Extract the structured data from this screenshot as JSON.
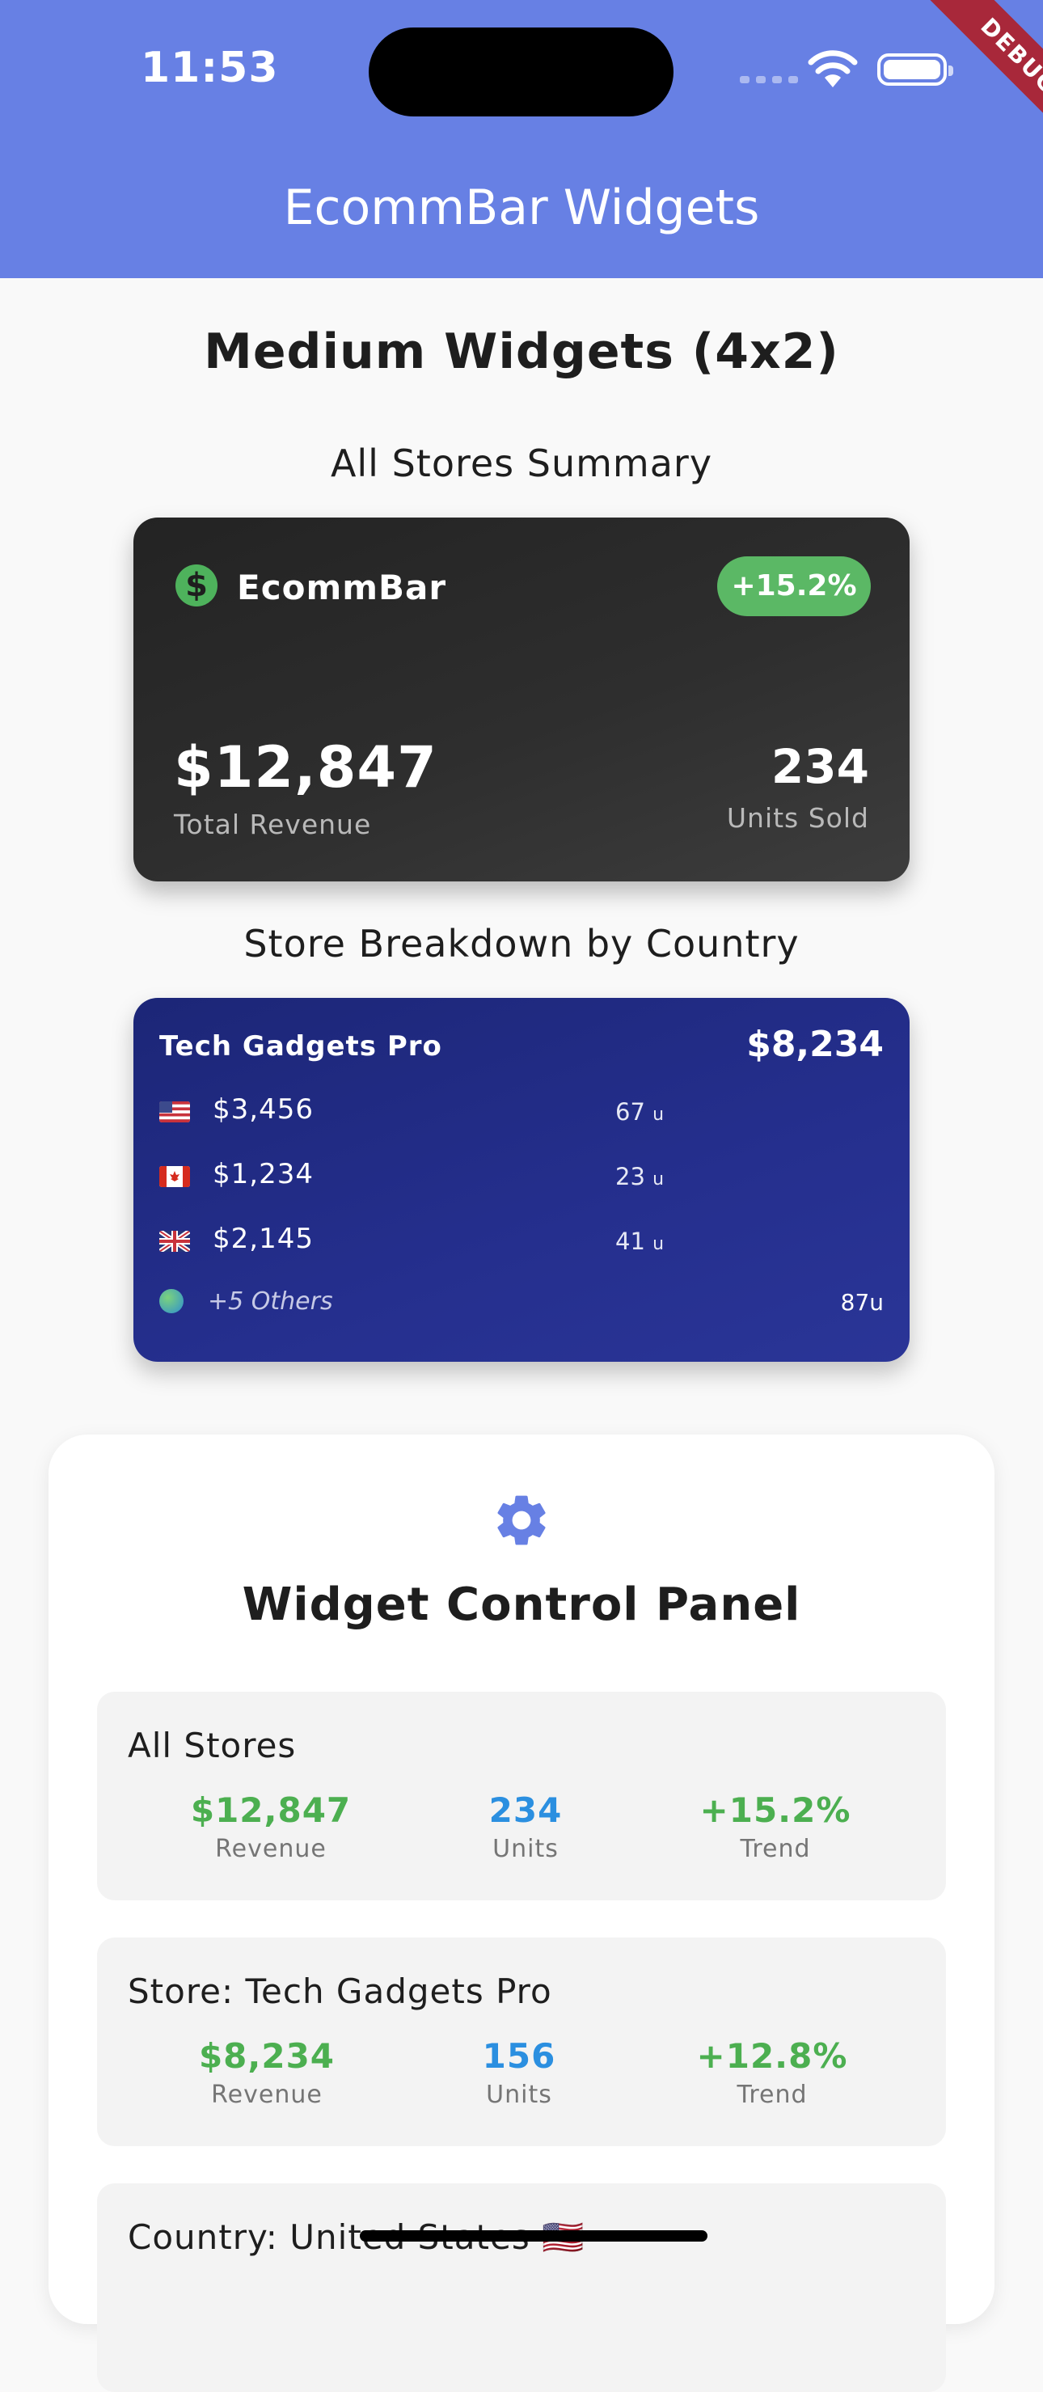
{
  "status_bar": {
    "time": "11:53",
    "debug_banner": "DEBUG"
  },
  "app_bar": {
    "title": "EcommBar Widgets"
  },
  "section_title": "Medium Widgets (4x2)",
  "summary_widget": {
    "heading": "All Stores Summary",
    "brand": "EcommBar",
    "trend": "+15.2%",
    "revenue": "$12,847",
    "revenue_label": "Total Revenue",
    "units": "234",
    "units_label": "Units Sold",
    "colors": {
      "card": "#2b2b2b",
      "pill": "#5bb865"
    }
  },
  "breakdown_widget": {
    "heading": "Store Breakdown by Country",
    "store_name": "Tech Gadgets Pro",
    "store_total": "$8,234",
    "rows": [
      {
        "country": "US",
        "amount": "$3,456",
        "units": "67",
        "unit_suffix": "u"
      },
      {
        "country": "CA",
        "amount": "$1,234",
        "units": "23",
        "unit_suffix": "u"
      },
      {
        "country": "GB",
        "amount": "$2,145",
        "units": "41",
        "unit_suffix": "u"
      }
    ],
    "others_label": "+5 Others",
    "others_units": "87u",
    "colors": {
      "card": "#232d87"
    }
  },
  "control_panel": {
    "icon": "gear-icon",
    "title": "Widget Control Panel",
    "sections": [
      {
        "title": "All Stores",
        "stats": [
          {
            "value": "$12,847",
            "label": "Revenue"
          },
          {
            "value": "234",
            "label": "Units"
          },
          {
            "value": "+15.2%",
            "label": "Trend"
          }
        ]
      },
      {
        "title": "Store: Tech Gadgets Pro",
        "stats": [
          {
            "value": "$8,234",
            "label": "Revenue"
          },
          {
            "value": "156",
            "label": "Units"
          },
          {
            "value": "+12.8%",
            "label": "Trend"
          }
        ]
      },
      {
        "title": "Country: United States 🇺🇸"
      }
    ],
    "colors": {
      "accent": "#6780e4",
      "positive": "#4caf50",
      "units": "#2b8fe0"
    }
  }
}
